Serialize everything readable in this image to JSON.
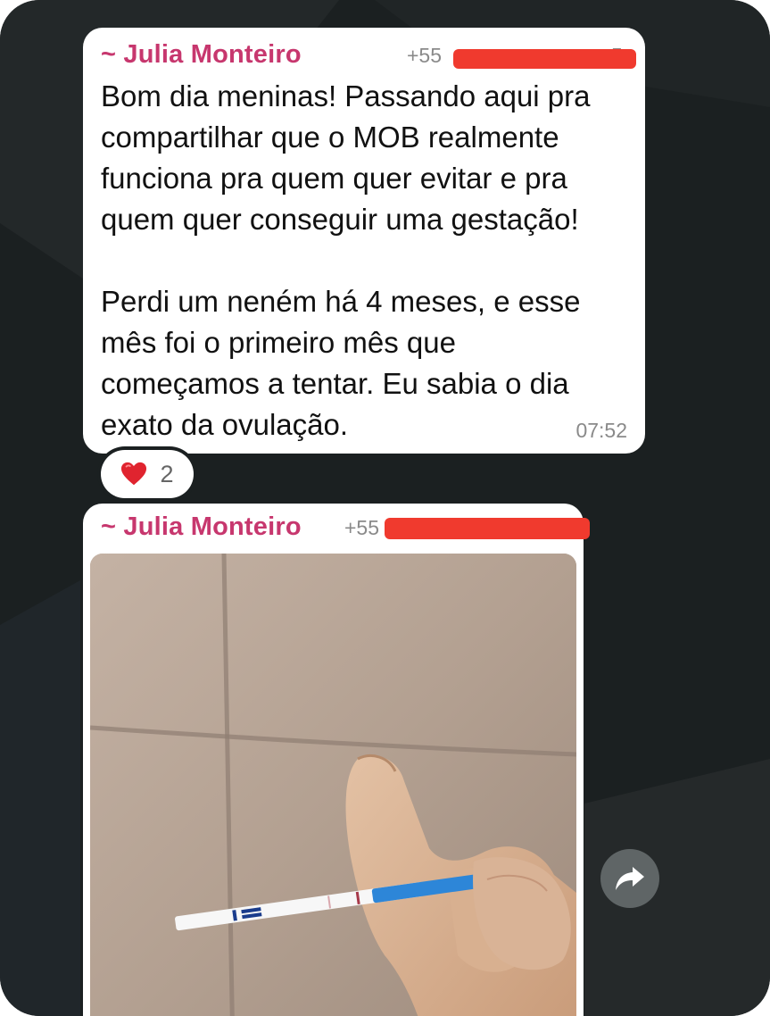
{
  "messages": [
    {
      "sender": "~ Julia Monteiro",
      "phone_prefix": "+55",
      "phone_suffix": "5",
      "text": "Bom dia meninas! Passando aqui pra\ncompartilhar que o MOB realmente\nfunciona pra quem quer evitar e pra\nquem quer conseguir uma gestação!\n\nPerdi um neném há 4 meses, e esse\nmês foi o primeiro mês que\ncomeçamos a tentar. Eu sabia o dia\nexato da ovulação.",
      "time": "07:52",
      "reaction": {
        "icon": "heart-icon",
        "count": "2"
      }
    },
    {
      "sender": "~ Julia Monteiro",
      "phone_prefix": "+55",
      "image": {
        "subject": "photo-of-ovulation-test-strip"
      }
    }
  ],
  "colors": {
    "sender": "#c7376e",
    "redaction": "#f03a2e",
    "background": "#1b2021"
  },
  "icons": {
    "forward": "share-forward-icon"
  }
}
